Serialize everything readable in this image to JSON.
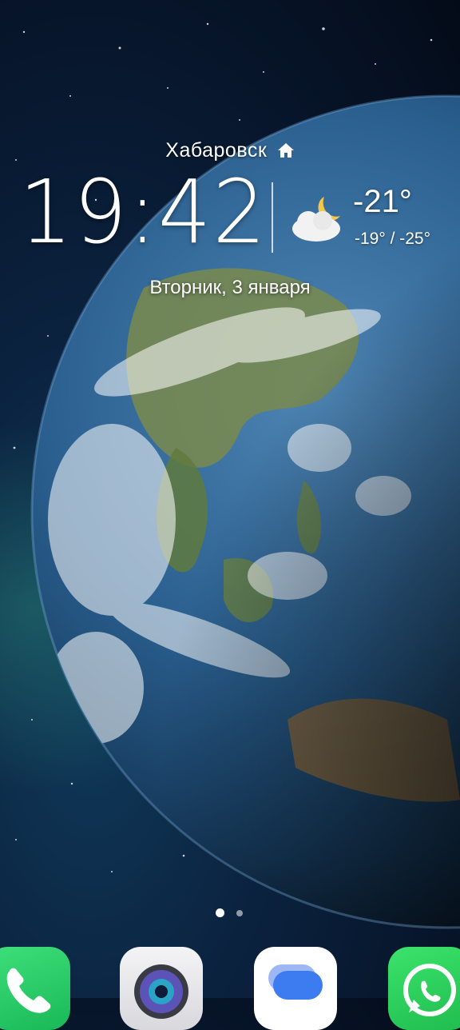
{
  "lockscreen": {
    "city": "Хабаровск",
    "time": "19:42",
    "date": "Вторник, 3 января",
    "weather": {
      "icon": "moon-cloud-icon",
      "temperature": "-21°",
      "range": "-19° / -25°"
    }
  },
  "pager": {
    "page_count": 2,
    "current_page": 1
  },
  "dock": [
    {
      "name": "phone-app-icon"
    },
    {
      "name": "camera-app-icon"
    },
    {
      "name": "messages-app-icon"
    },
    {
      "name": "whatsapp-app-icon"
    }
  ],
  "colors": {
    "space": "#07152a",
    "ocean": "#1d5a8e",
    "land": "#6f8a4a",
    "phone": "#2ccf6a",
    "whatsapp": "#25c25a",
    "messages_blue": "#3d7bf0"
  }
}
